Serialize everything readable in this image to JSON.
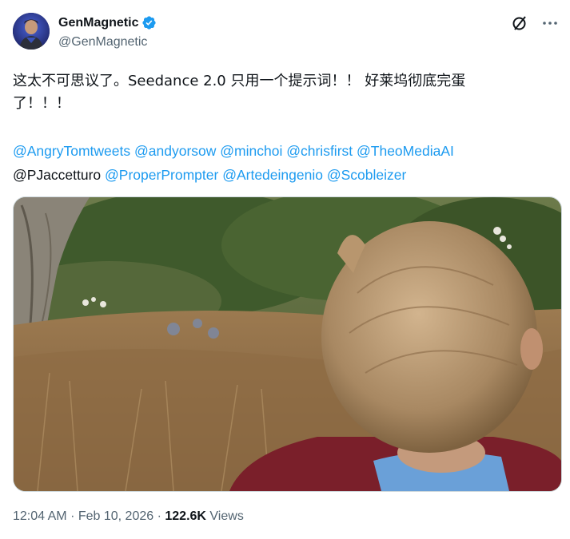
{
  "author": {
    "display_name": "GenMagnetic",
    "handle": "@GenMagnetic",
    "verified": true,
    "verified_color": "#1d9bf0"
  },
  "actions": {
    "grok_icon": "slashed-circle-icon",
    "more_icon": "more-dots-icon"
  },
  "tweet": {
    "text_line1": "这太不可思议了。Seedance 2.0 只用一个提示词！！ 好莱坞彻底完蛋",
    "text_line2": "了！！！",
    "mentions_line1": [
      "@AngryTomtweets",
      "@andyorsow",
      "@minchoi",
      "@chrisfirst",
      "@TheoMediaAI"
    ],
    "mentions_line2_plain": "@PJaccetturo",
    "mentions_line2": [
      "@ProperPrompter",
      "@Artedeingenio",
      "@Scobleizer"
    ],
    "mention_color": "#1d9bf0"
  },
  "media": {
    "type": "video-still"
  },
  "meta": {
    "time": "12:04 AM",
    "separator": "·",
    "date": "Feb 10, 2026",
    "views_count": "122.6K",
    "views_label": "Views"
  }
}
